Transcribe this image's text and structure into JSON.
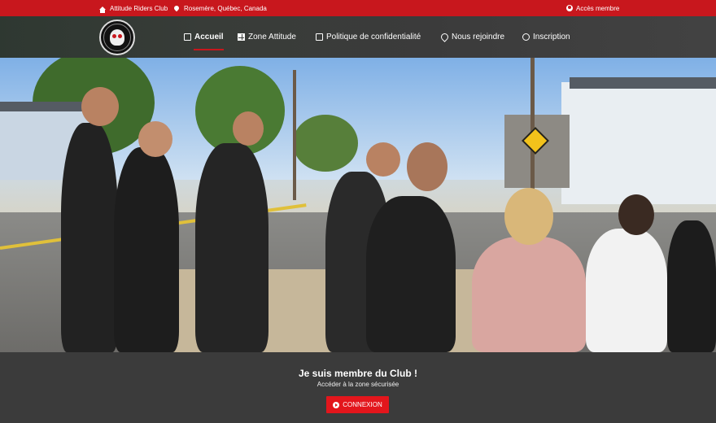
{
  "topbar": {
    "club_name": "Attitude Riders Club",
    "location": "Rosemère, Québec, Canada",
    "member_access": "Accès membre"
  },
  "nav": {
    "items": [
      {
        "label": "Accueil",
        "icon": "home-icon",
        "active": true
      },
      {
        "label": "Zone Attitude",
        "icon": "grid-icon",
        "active": false
      },
      {
        "label": "Politique de confidentialité",
        "icon": "lock-icon",
        "active": false
      },
      {
        "label": "Nous rejoindre",
        "icon": "map-pin-icon",
        "active": false
      },
      {
        "label": "Inscription",
        "icon": "user-plus-icon",
        "active": false
      }
    ]
  },
  "banner": {
    "title": "Je suis membre du Club !",
    "subtitle": "Accéder à la zone sécurisée",
    "button_label": "CONNEXION"
  },
  "colors": {
    "brand_red": "#c8171d",
    "button_red": "#e3161c",
    "nav_bg": "#3d3d3d"
  }
}
